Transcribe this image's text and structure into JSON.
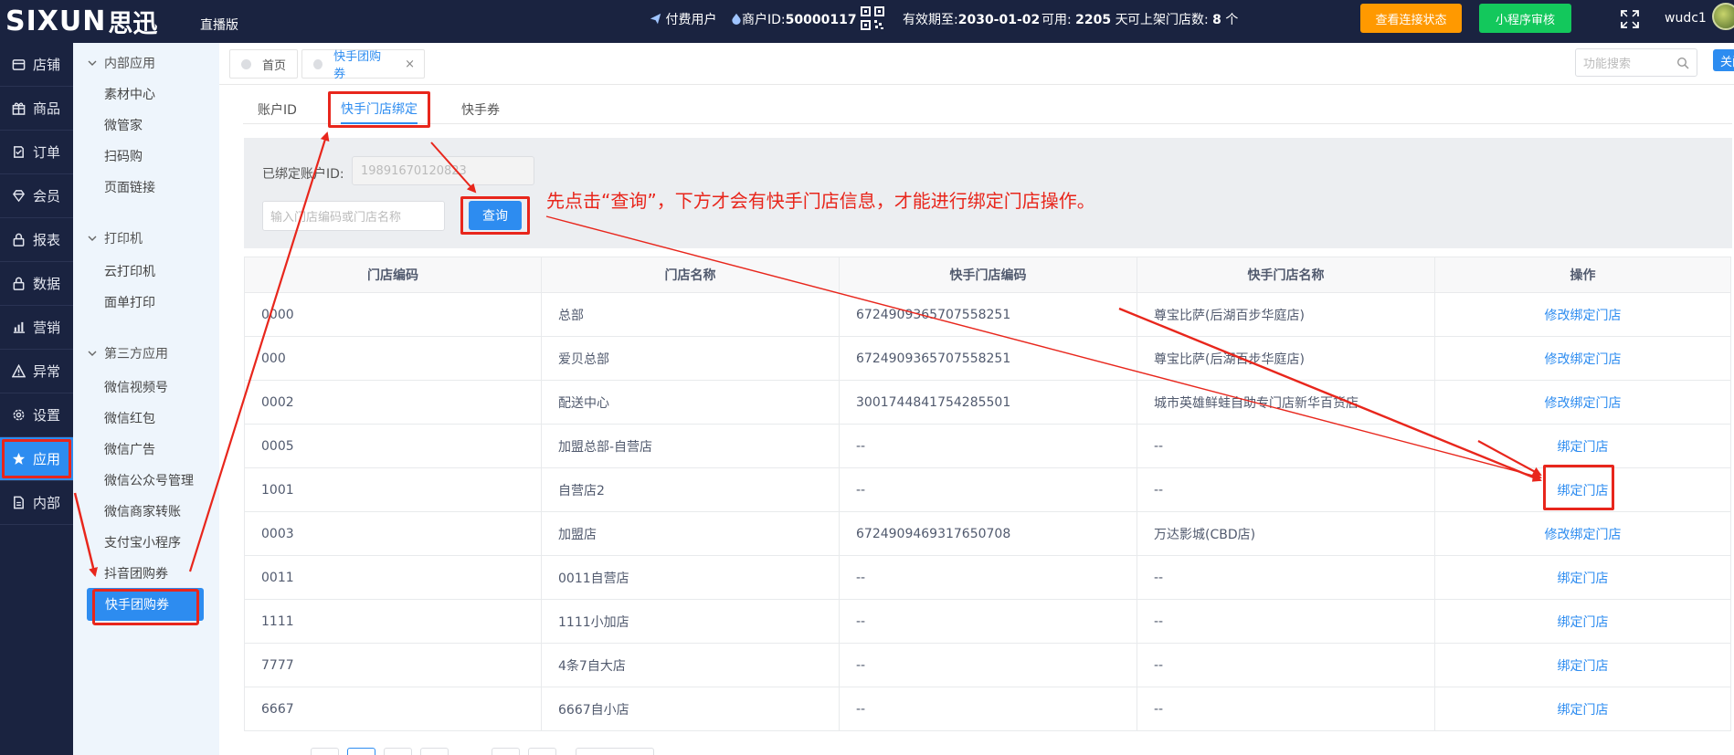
{
  "topbar": {
    "logo_en": "SIXUN",
    "logo_cn": "思迅",
    "edition": "直播版",
    "user_type": "付费用户",
    "merchant_label": "商户ID:",
    "merchant_id": "50000117",
    "expiry_label": "有效期至:",
    "expiry": "2030-01-02",
    "available_label": "可用:",
    "available_days": "2205",
    "days_unit": "天",
    "store_count_label": "可上架门店数:",
    "store_count": "8",
    "store_unit": "个",
    "check_status_btn": "查看连接状态",
    "mini_program_btn": "小程序审核",
    "username": "wudc1"
  },
  "leftnav": {
    "items": [
      {
        "label": "店铺",
        "icon": "store-icon"
      },
      {
        "label": "商品",
        "icon": "gift-icon"
      },
      {
        "label": "订单",
        "icon": "order-icon"
      },
      {
        "label": "会员",
        "icon": "diamond-icon"
      },
      {
        "label": "报表",
        "icon": "lock-icon"
      },
      {
        "label": "数据",
        "icon": "lock-icon"
      },
      {
        "label": "营销",
        "icon": "bar-chart-icon"
      },
      {
        "label": "异常",
        "icon": "warning-icon"
      },
      {
        "label": "设置",
        "icon": "gear-icon"
      },
      {
        "label": "应用",
        "icon": "star-icon",
        "active": true
      },
      {
        "label": "内部",
        "icon": "document-icon"
      }
    ]
  },
  "subnav": {
    "group1": "内部应用",
    "group1_items": [
      "素材中心",
      "微管家",
      "扫码购",
      "页面链接"
    ],
    "group2": "打印机",
    "group2_items": [
      "云打印机",
      "面单打印"
    ],
    "group3": "第三方应用",
    "group3_items": [
      "微信视频号",
      "微信红包",
      "微信广告",
      "微信公众号管理",
      "微信商家转账",
      "支付宝小程序",
      "抖音团购券",
      "快手团购券"
    ]
  },
  "tabstrip": {
    "tabs": [
      "首页",
      "快手团购券"
    ],
    "search_placeholder": "功能搜索",
    "close_label": "关闭"
  },
  "content": {
    "tabs": [
      "账户ID",
      "快手门店绑定",
      "快手券"
    ],
    "bound_label": "已绑定账户ID:",
    "bound_value": "19891670120823",
    "store_input_placeholder": "输入门店编码或门店名称",
    "query_btn": "查询",
    "annotation": "先点击“查询”，下方才会有快手门店信息，才能进行绑定门店操作。"
  },
  "table": {
    "headers": [
      "门店编码",
      "门店名称",
      "快手门店编码",
      "快手门店名称",
      "操作"
    ],
    "rows": [
      [
        "0000",
        "总部",
        "6724909365707558251",
        "尊宝比萨(后湖百步华庭店)",
        "修改绑定门店"
      ],
      [
        "000",
        "爱贝总部",
        "6724909365707558251",
        "尊宝比萨(后湖百步华庭店)",
        "修改绑定门店"
      ],
      [
        "0002",
        "配送中心",
        "3001744841754285501",
        "城市英雄鲜蛙自助专门店新华百货店",
        "修改绑定门店"
      ],
      [
        "0005",
        "加盟总部-自营店",
        "--",
        "--",
        "绑定门店"
      ],
      [
        "1001",
        "自营店2",
        "--",
        "--",
        "绑定门店"
      ],
      [
        "0003",
        "加盟店",
        "6724909469317650708",
        "万达影城(CBD店)",
        "修改绑定门店"
      ],
      [
        "0011",
        "0011自营店",
        "--",
        "--",
        "绑定门店"
      ],
      [
        "1111",
        "1111小加店",
        "--",
        "--",
        "绑定门店"
      ],
      [
        "7777",
        "4条7自大店",
        "--",
        "--",
        "绑定门店"
      ],
      [
        "6667",
        "6667自小店",
        "--",
        "--",
        "绑定门店"
      ]
    ]
  },
  "colors": {
    "nav_bg": "#1a2340",
    "accent": "#2d8cf0",
    "highlight": "#e8261c",
    "orange": "#ff9900",
    "green": "#13c85c"
  }
}
